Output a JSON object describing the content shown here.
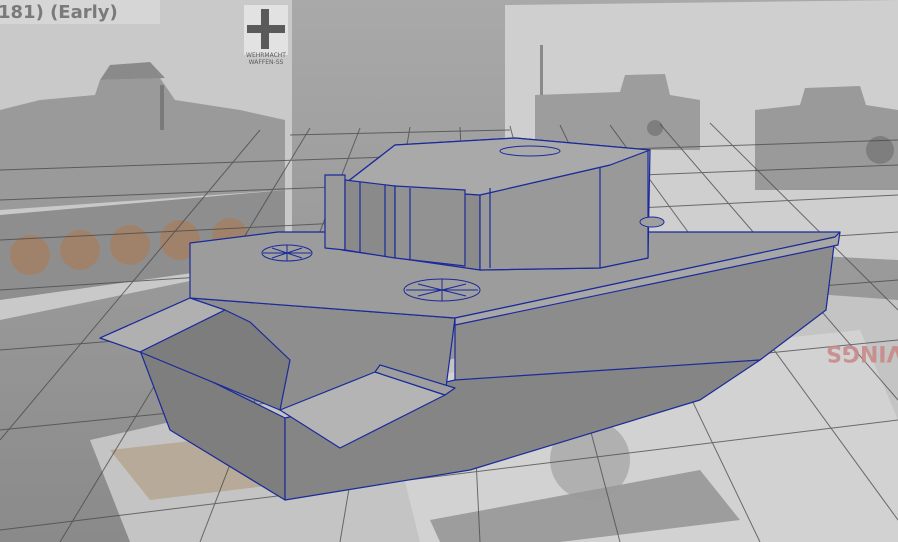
{
  "viewport": {
    "reference_title": "181) (Early)",
    "insignia_line1": "WEHRMACHT",
    "insignia_line2": "WAFFEN-SS",
    "floor_mirrored_text": "VINGS",
    "colors": {
      "wireframe": "#1a2a9a",
      "model_face": "#8d8d8d",
      "model_top": "#a3a3a3",
      "grid_line": "#4a4a4a",
      "reference_plane": "#bdbdbd"
    }
  }
}
